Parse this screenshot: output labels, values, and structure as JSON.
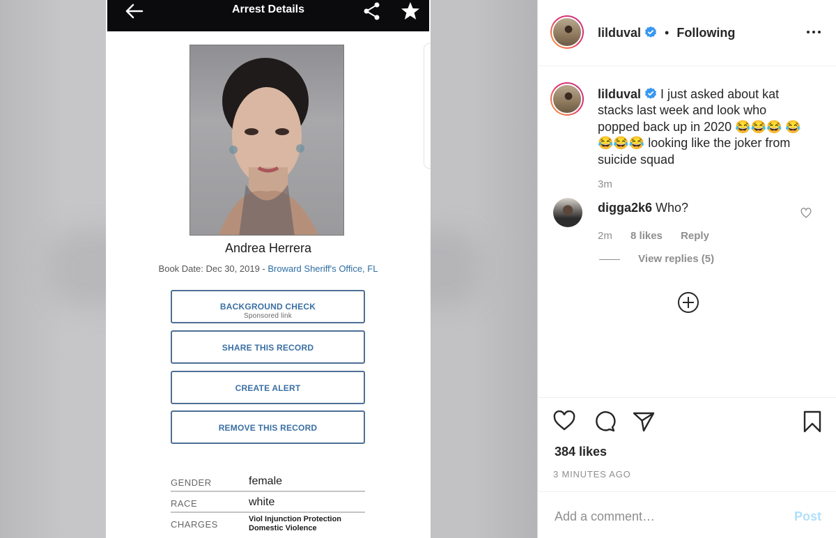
{
  "photo": {
    "app_title": "Arrest Details",
    "person_name": "Andrea Herrera",
    "book_date": "Book Date: Dec 30, 2019 -",
    "agency": "Broward Sheriff's Office, FL",
    "buttons": [
      {
        "label": "BACKGROUND CHECK",
        "sub": "Sponsored link"
      },
      {
        "label": "SHARE THIS RECORD",
        "sub": ""
      },
      {
        "label": "CREATE ALERT",
        "sub": ""
      },
      {
        "label": "REMOVE THIS RECORD",
        "sub": ""
      }
    ],
    "details": [
      {
        "key": "GENDER",
        "value": "female"
      },
      {
        "key": "RACE",
        "value": "white"
      },
      {
        "key": "CHARGES",
        "value": "Viol Injunction Protection Domestic Violence"
      }
    ]
  },
  "post": {
    "username": "lilduval",
    "separator": "•",
    "follow_status": "Following",
    "caption_text": "I just asked about kat stacks last week and look who popped back up in 2020 😂😂😂 😂😂😂😂 looking like the joker from suicide squad",
    "caption_time": "3m",
    "comment": {
      "username": "digga2k6",
      "text": "Who?",
      "time": "2m",
      "likes": "8 likes",
      "reply_label": "Reply",
      "view_replies": "View replies (5)"
    },
    "likes": "384 likes",
    "time_ago": "3 MINUTES AGO",
    "comment_placeholder": "Add a comment…",
    "post_label": "Post"
  },
  "colors": {
    "link_blue": "#3a6fa3",
    "verified_blue": "#3897f0",
    "post_disabled": "#b2dffc"
  },
  "icons": [
    "back-arrow-icon",
    "share-icon",
    "star-icon",
    "verified-icon",
    "more-icon",
    "heart-icon",
    "comment-icon",
    "send-icon",
    "bookmark-icon",
    "plus-circle-icon"
  ]
}
